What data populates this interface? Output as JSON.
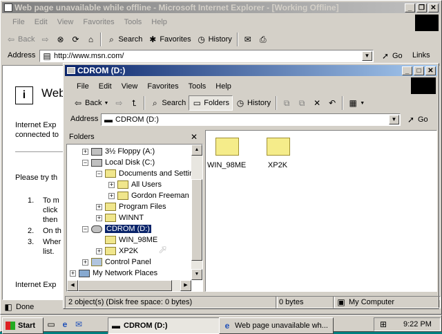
{
  "ie_window": {
    "title": "Web page unavailable while offline - Microsoft Internet Explorer - [Working Offline]",
    "menu": [
      "File",
      "Edit",
      "View",
      "Favorites",
      "Tools",
      "Help"
    ],
    "toolbar": {
      "back": "Back",
      "search": "Search",
      "favorites": "Favorites",
      "history": "History"
    },
    "address_label": "Address",
    "address_value": "http://www.msn.com/",
    "go": "Go",
    "links": "Links",
    "page": {
      "heading_partial": "Web",
      "para1a": "Internet Exp",
      "para1b": "connected to",
      "try_line": "Please try th",
      "list": [
        "1.",
        "To m",
        "click",
        "then",
        "2.",
        "On th",
        "3.",
        "Wher",
        "list."
      ],
      "footer_partial": "Internet Exp"
    },
    "status_done": "Done"
  },
  "explorer_window": {
    "title": "CDROM (D:)",
    "menu": [
      "File",
      "Edit",
      "View",
      "Favorites",
      "Tools",
      "Help"
    ],
    "toolbar": {
      "back": "Back",
      "search": "Search",
      "folders": "Folders",
      "history": "History"
    },
    "address_label": "Address",
    "address_value": "CDROM (D:)",
    "go": "Go",
    "folders_pane_title": "Folders",
    "tree": [
      {
        "label": "3½ Floppy (A:)"
      },
      {
        "label": "Local Disk (C:)"
      },
      {
        "label": "Documents and Settin"
      },
      {
        "label": "All Users"
      },
      {
        "label": "Gordon Freeman"
      },
      {
        "label": "Program Files"
      },
      {
        "label": "WINNT"
      },
      {
        "label": "CDROM (D:)"
      },
      {
        "label": "WIN_98ME"
      },
      {
        "label": "XP2K"
      },
      {
        "label": "Control Panel"
      },
      {
        "label": "My Network Places"
      }
    ],
    "files": [
      {
        "name": "WIN_98ME"
      },
      {
        "name": "XP2K"
      }
    ],
    "status": {
      "objects": "2 object(s) (Disk free space: 0 bytes)",
      "size": "0 bytes",
      "location": "My Computer"
    }
  },
  "taskbar": {
    "start": "Start",
    "tasks": [
      "CDROM (D:)",
      "Web page unavailable wh..."
    ],
    "clock": "9:22 PM"
  }
}
